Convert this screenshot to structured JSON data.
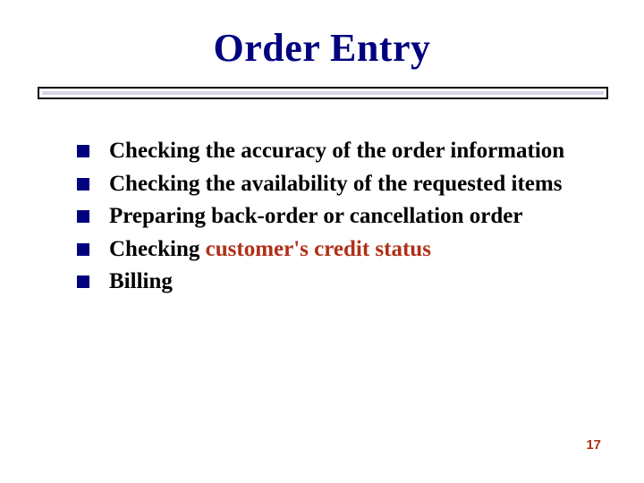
{
  "title": "Order Entry",
  "bullets": [
    {
      "pre": "Checking the accuracy of the order information",
      "hl": "",
      "post": ""
    },
    {
      "pre": "Checking the availability of the requested items",
      "hl": "",
      "post": ""
    },
    {
      "pre": "Preparing back-order or cancellation  order",
      "hl": "",
      "post": ""
    },
    {
      "pre": "Checking ",
      "hl": "customer's credit status",
      "post": ""
    },
    {
      "pre": "Billing",
      "hl": "",
      "post": ""
    }
  ],
  "page_number": "17"
}
